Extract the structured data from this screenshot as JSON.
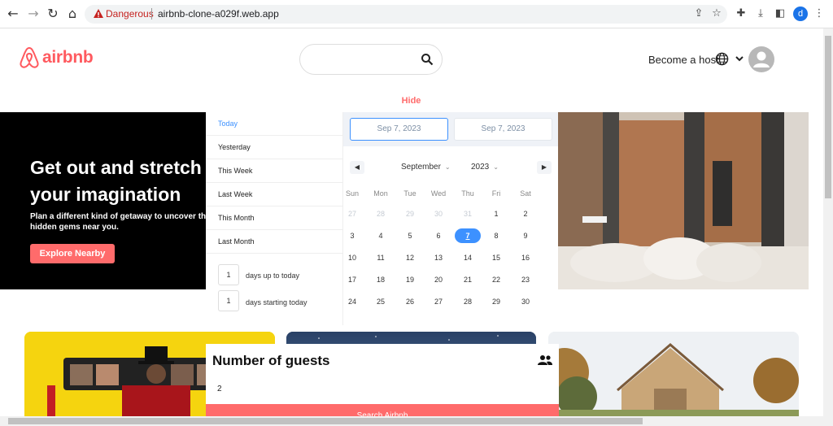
{
  "browser": {
    "security_label": "Dangerous",
    "url": "airbnb-clone-a029f.web.app",
    "profile_initial": "d",
    "icons": [
      "back-icon",
      "forward-icon",
      "reload-icon",
      "home-icon",
      "warning-icon",
      "share-icon",
      "star-icon",
      "extensions-icon",
      "download-icon",
      "sidepanel-icon"
    ]
  },
  "header": {
    "logo_text": "airbnb",
    "search_placeholder": "",
    "become_host": "Become a host"
  },
  "hide_label": "Hide",
  "hero": {
    "title": "Get out and stretch your imagination",
    "subtitle": "Plan a different kind of getaway to uncover the hidden gems near you.",
    "cta": "Explore Nearby"
  },
  "date_picker": {
    "ranges": [
      {
        "label": "Today",
        "active": true
      },
      {
        "label": "Yesterday",
        "active": false
      },
      {
        "label": "This Week",
        "active": false
      },
      {
        "label": "Last Week",
        "active": false
      },
      {
        "label": "This Month",
        "active": false
      },
      {
        "label": "Last Month",
        "active": false
      }
    ],
    "days_up_to_today": {
      "value": "1",
      "label": "days up to today"
    },
    "days_starting_today": {
      "value": "1",
      "label": "days starting today"
    },
    "start_date": "Sep 7, 2023",
    "end_date": "Sep 7, 2023",
    "month": "September",
    "year": "2023",
    "weekdays": [
      "Sun",
      "Mon",
      "Tue",
      "Wed",
      "Thu",
      "Fri",
      "Sat"
    ],
    "weeks": [
      [
        {
          "d": "27",
          "m": true
        },
        {
          "d": "28",
          "m": true
        },
        {
          "d": "29",
          "m": true
        },
        {
          "d": "30",
          "m": true
        },
        {
          "d": "31",
          "m": true
        },
        {
          "d": "1"
        },
        {
          "d": "2"
        }
      ],
      [
        {
          "d": "3"
        },
        {
          "d": "4"
        },
        {
          "d": "5"
        },
        {
          "d": "6"
        },
        {
          "d": "7",
          "s": true
        },
        {
          "d": "8"
        },
        {
          "d": "9"
        }
      ],
      [
        {
          "d": "10"
        },
        {
          "d": "11"
        },
        {
          "d": "12"
        },
        {
          "d": "13"
        },
        {
          "d": "14"
        },
        {
          "d": "15"
        },
        {
          "d": "16"
        }
      ],
      [
        {
          "d": "17"
        },
        {
          "d": "18"
        },
        {
          "d": "19"
        },
        {
          "d": "20"
        },
        {
          "d": "21"
        },
        {
          "d": "22"
        },
        {
          "d": "23"
        }
      ],
      [
        {
          "d": "24"
        },
        {
          "d": "25"
        },
        {
          "d": "26"
        },
        {
          "d": "27"
        },
        {
          "d": "28"
        },
        {
          "d": "29"
        },
        {
          "d": "30"
        }
      ]
    ]
  },
  "guests": {
    "title": "Number of guests",
    "count": "2",
    "search_button": "Search Airbnb"
  },
  "colors": {
    "brand": "#ff5a5f",
    "accent": "#ff6b6b",
    "selected": "#3d91ff"
  }
}
